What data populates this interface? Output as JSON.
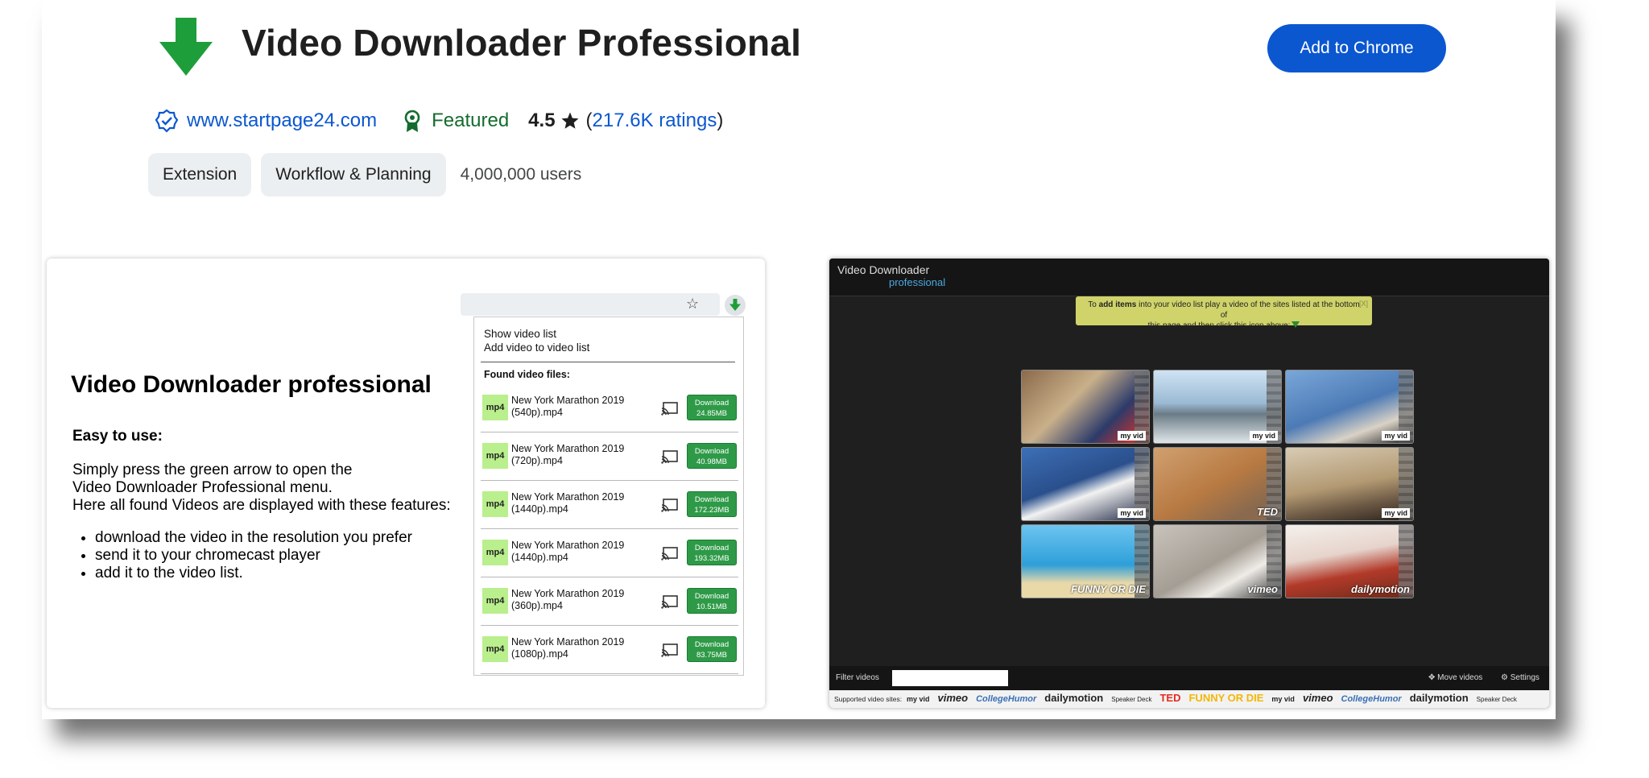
{
  "header": {
    "title": "Video Downloader Professional",
    "add_button": "Add to Chrome",
    "website": "www.startpage24.com",
    "featured": "Featured",
    "rating": "4.5",
    "ratings_paren_open": "(",
    "ratings_link": "217.6K ratings",
    "ratings_paren_close": ")",
    "chips": [
      "Extension",
      "Workflow & Planning"
    ],
    "users": "4,000,000 users",
    "colors": {
      "accent": "#0b57d0",
      "featured": "#146c2e",
      "logo_green": "#1e9e3a"
    }
  },
  "screenshot1": {
    "title": "Video Downloader professional",
    "subtitle": "Easy to use:",
    "description": [
      "Simply press the green arrow to open the",
      "Video Downloader Professional menu.",
      "Here all found Videos are displayed with these features:"
    ],
    "features": [
      "download the video in the resolution you prefer",
      "send it to your chromecast player",
      "add it to the video list."
    ],
    "popup": {
      "menu": [
        "Show video list",
        "Add video to video list"
      ],
      "found_label": "Found video files:",
      "files": [
        {
          "format": "mp4",
          "name_line1": "New York Marathon 2019",
          "name_line2": "(540p).mp4",
          "dl_line1": "Download",
          "dl_line2": "24.85MB"
        },
        {
          "format": "mp4",
          "name_line1": "New York Marathon 2019",
          "name_line2": "(720p).mp4",
          "dl_line1": "Download",
          "dl_line2": "40.98MB"
        },
        {
          "format": "mp4",
          "name_line1": "New York Marathon 2019",
          "name_line2": "(1440p).mp4",
          "dl_line1": "Download",
          "dl_line2": "172.23MB"
        },
        {
          "format": "mp4",
          "name_line1": "New York Marathon 2019",
          "name_line2": "(1440p).mp4",
          "dl_line1": "Download",
          "dl_line2": "193.32MB"
        },
        {
          "format": "mp4",
          "name_line1": "New York Marathon 2019",
          "name_line2": "(360p).mp4",
          "dl_line1": "Download",
          "dl_line2": "10.51MB"
        },
        {
          "format": "mp4",
          "name_line1": "New York Marathon 2019",
          "name_line2": "(1080p).mp4",
          "dl_line1": "Download",
          "dl_line2": "83.75MB"
        }
      ]
    }
  },
  "screenshot2": {
    "brand_line1": "Video Downloader",
    "brand_line2": "professional",
    "notice_pre": "To ",
    "notice_bold": "add items",
    "notice_mid": " into your video list play a video of the sites listed at the bottom of",
    "notice_end": "this page and then click this icon above:",
    "notice_close": "[X]",
    "thumb_brands": [
      "my vid",
      "my vid",
      "my vid",
      "my vid",
      "TED",
      "my vid",
      "FUNNY OR DIE",
      "vimeo",
      "dailymotion"
    ],
    "filter_label": "Filter videos",
    "move_videos": "Move videos",
    "settings": "Settings",
    "supported_label": "Supported video sites:",
    "supported_sites": [
      "my vid",
      "vimeo",
      "CollegeHumor",
      "dailymotion",
      "Speaker Deck",
      "TED",
      "FUNNY OR DIE",
      "my vid",
      "vimeo",
      "CollegeHumor",
      "dailymotion",
      "Speaker Deck"
    ]
  }
}
